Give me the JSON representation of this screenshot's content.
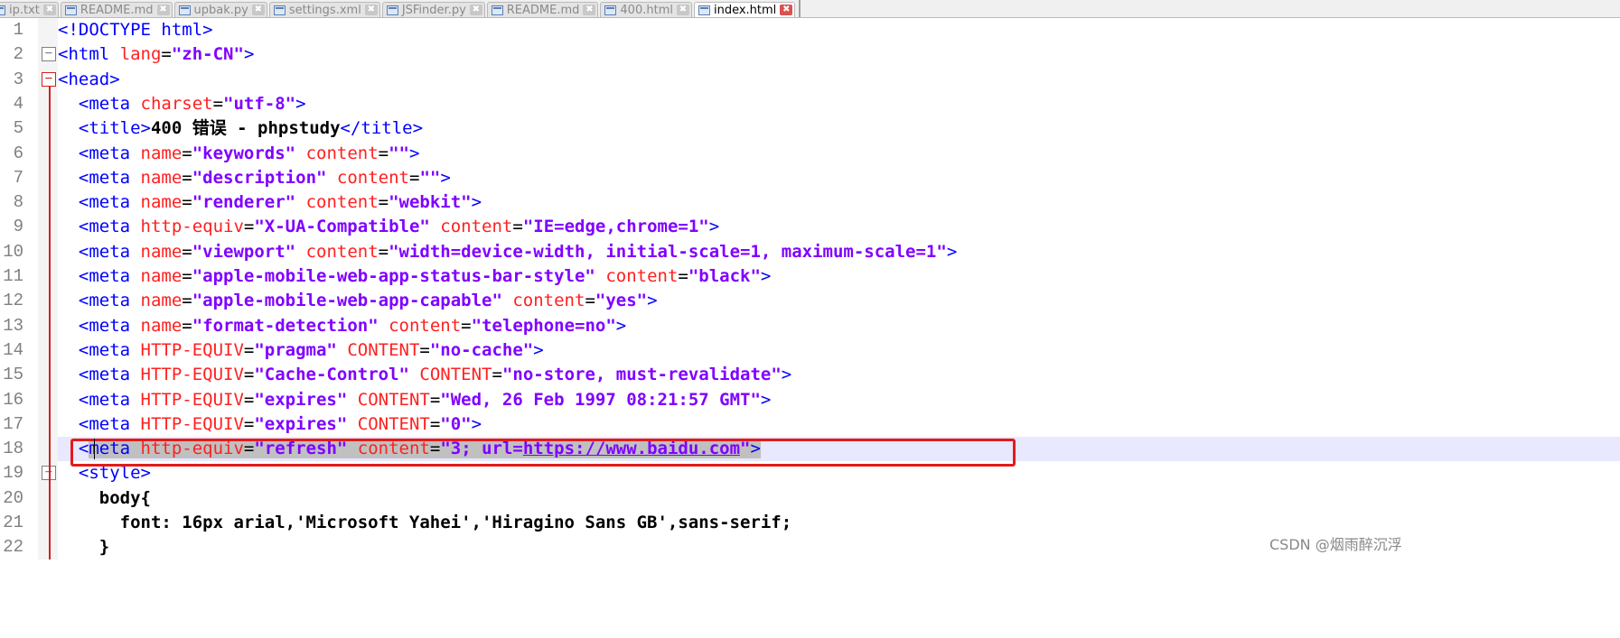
{
  "tabs": [
    {
      "label": "ip.txt"
    },
    {
      "label": "README.md"
    },
    {
      "label": "upbak.py"
    },
    {
      "label": "settings.xml"
    },
    {
      "label": "JSFinder.py"
    },
    {
      "label": "README.md"
    },
    {
      "label": "400.html"
    },
    {
      "label": "index.html",
      "active": true
    }
  ],
  "lines": [
    {
      "n": "1",
      "tokens": [
        [
          "tag",
          "<!DOCTYPE html>"
        ]
      ]
    },
    {
      "n": "2",
      "tokens": [
        [
          "tag",
          "<html "
        ],
        [
          "attr",
          "lang"
        ],
        [
          "eq",
          "="
        ],
        [
          "str",
          "\"zh-CN\""
        ],
        [
          "tag",
          ">"
        ]
      ]
    },
    {
      "n": "3",
      "tokens": [
        [
          "tag",
          "<head>"
        ]
      ]
    },
    {
      "n": "4",
      "tokens": [
        [
          "tag",
          "  <meta "
        ],
        [
          "attr",
          "charset"
        ],
        [
          "eq",
          "="
        ],
        [
          "str",
          "\"utf-8\""
        ],
        [
          "tag",
          ">"
        ]
      ]
    },
    {
      "n": "5",
      "tokens": [
        [
          "tag",
          "  <title>"
        ],
        [
          "txt",
          "400 错误 - phpstudy"
        ],
        [
          "tag",
          "</title>"
        ]
      ]
    },
    {
      "n": "6",
      "tokens": [
        [
          "tag",
          "  <meta "
        ],
        [
          "attr",
          "name"
        ],
        [
          "eq",
          "="
        ],
        [
          "str",
          "\"keywords\""
        ],
        [
          "tag",
          " "
        ],
        [
          "attr",
          "content"
        ],
        [
          "eq",
          "="
        ],
        [
          "str",
          "\"\""
        ],
        [
          "tag",
          ">"
        ]
      ]
    },
    {
      "n": "7",
      "tokens": [
        [
          "tag",
          "  <meta "
        ],
        [
          "attr",
          "name"
        ],
        [
          "eq",
          "="
        ],
        [
          "str",
          "\"description\""
        ],
        [
          "tag",
          " "
        ],
        [
          "attr",
          "content"
        ],
        [
          "eq",
          "="
        ],
        [
          "str",
          "\"\""
        ],
        [
          "tag",
          ">"
        ]
      ]
    },
    {
      "n": "8",
      "tokens": [
        [
          "tag",
          "  <meta "
        ],
        [
          "attr",
          "name"
        ],
        [
          "eq",
          "="
        ],
        [
          "str",
          "\"renderer\""
        ],
        [
          "tag",
          " "
        ],
        [
          "attr",
          "content"
        ],
        [
          "eq",
          "="
        ],
        [
          "str",
          "\"webkit\""
        ],
        [
          "tag",
          ">"
        ]
      ]
    },
    {
      "n": "9",
      "tokens": [
        [
          "tag",
          "  <meta "
        ],
        [
          "attr",
          "http-equiv"
        ],
        [
          "eq",
          "="
        ],
        [
          "str",
          "\"X-UA-Compatible\""
        ],
        [
          "tag",
          " "
        ],
        [
          "attr",
          "content"
        ],
        [
          "eq",
          "="
        ],
        [
          "str",
          "\"IE=edge,chrome=1\""
        ],
        [
          "tag",
          ">"
        ]
      ]
    },
    {
      "n": "10",
      "tokens": [
        [
          "tag",
          "  <meta "
        ],
        [
          "attr",
          "name"
        ],
        [
          "eq",
          "="
        ],
        [
          "str",
          "\"viewport\""
        ],
        [
          "tag",
          " "
        ],
        [
          "attr",
          "content"
        ],
        [
          "eq",
          "="
        ],
        [
          "str",
          "\"width=device-width, initial-scale=1, maximum-scale=1\""
        ],
        [
          "tag",
          ">"
        ]
      ]
    },
    {
      "n": "11",
      "tokens": [
        [
          "tag",
          "  <meta "
        ],
        [
          "attr",
          "name"
        ],
        [
          "eq",
          "="
        ],
        [
          "str",
          "\"apple-mobile-web-app-status-bar-style\""
        ],
        [
          "tag",
          " "
        ],
        [
          "attr",
          "content"
        ],
        [
          "eq",
          "="
        ],
        [
          "str",
          "\"black\""
        ],
        [
          "tag",
          ">"
        ]
      ]
    },
    {
      "n": "12",
      "tokens": [
        [
          "tag",
          "  <meta "
        ],
        [
          "attr",
          "name"
        ],
        [
          "eq",
          "="
        ],
        [
          "str",
          "\"apple-mobile-web-app-capable\""
        ],
        [
          "tag",
          " "
        ],
        [
          "attr",
          "content"
        ],
        [
          "eq",
          "="
        ],
        [
          "str",
          "\"yes\""
        ],
        [
          "tag",
          ">"
        ]
      ]
    },
    {
      "n": "13",
      "tokens": [
        [
          "tag",
          "  <meta "
        ],
        [
          "attr",
          "name"
        ],
        [
          "eq",
          "="
        ],
        [
          "str",
          "\"format-detection\""
        ],
        [
          "tag",
          " "
        ],
        [
          "attr",
          "content"
        ],
        [
          "eq",
          "="
        ],
        [
          "str",
          "\"telephone=no\""
        ],
        [
          "tag",
          ">"
        ]
      ]
    },
    {
      "n": "14",
      "tokens": [
        [
          "tag",
          "  <meta "
        ],
        [
          "attr",
          "HTTP-EQUIV"
        ],
        [
          "eq",
          "="
        ],
        [
          "str",
          "\"pragma\""
        ],
        [
          "tag",
          " "
        ],
        [
          "attr",
          "CONTENT"
        ],
        [
          "eq",
          "="
        ],
        [
          "str",
          "\"no-cache\""
        ],
        [
          "tag",
          ">"
        ]
      ]
    },
    {
      "n": "15",
      "tokens": [
        [
          "tag",
          "  <meta "
        ],
        [
          "attr",
          "HTTP-EQUIV"
        ],
        [
          "eq",
          "="
        ],
        [
          "str",
          "\"Cache-Control\""
        ],
        [
          "tag",
          " "
        ],
        [
          "attr",
          "CONTENT"
        ],
        [
          "eq",
          "="
        ],
        [
          "str",
          "\"no-store, must-revalidate\""
        ],
        [
          "tag",
          ">"
        ]
      ]
    },
    {
      "n": "16",
      "tokens": [
        [
          "tag",
          "  <meta "
        ],
        [
          "attr",
          "HTTP-EQUIV"
        ],
        [
          "eq",
          "="
        ],
        [
          "str",
          "\"expires\""
        ],
        [
          "tag",
          " "
        ],
        [
          "attr",
          "CONTENT"
        ],
        [
          "eq",
          "="
        ],
        [
          "str",
          "\"Wed, 26 Feb 1997 08:21:57 GMT\""
        ],
        [
          "tag",
          ">"
        ]
      ]
    },
    {
      "n": "17",
      "tokens": [
        [
          "tag",
          "  <meta "
        ],
        [
          "attr",
          "HTTP-EQUIV"
        ],
        [
          "eq",
          "="
        ],
        [
          "str",
          "\"expires\""
        ],
        [
          "tag",
          " "
        ],
        [
          "attr",
          "CONTENT"
        ],
        [
          "eq",
          "="
        ],
        [
          "str",
          "\"0\""
        ],
        [
          "tag",
          ">"
        ]
      ]
    },
    {
      "n": "18",
      "tokens": [
        [
          "tag",
          "  <"
        ],
        [
          "tag",
          "meta "
        ],
        [
          "attr",
          "http-equiv"
        ],
        [
          "eq",
          "="
        ],
        [
          "str",
          "\"refresh\""
        ],
        [
          "tag",
          " "
        ],
        [
          "attr",
          "content"
        ],
        [
          "eq",
          "="
        ],
        [
          "str",
          "\"3; url="
        ],
        [
          "strurl",
          "https://www.baidu.com"
        ],
        [
          "str",
          "\""
        ],
        [
          "tag",
          ">"
        ]
      ],
      "highlight": true
    },
    {
      "n": "19",
      "tokens": [
        [
          "tag",
          "  <style>"
        ]
      ]
    },
    {
      "n": "20",
      "tokens": [
        [
          "css",
          "    body{"
        ]
      ]
    },
    {
      "n": "21",
      "tokens": [
        [
          "css",
          "      font: 16px arial,'Microsoft Yahei','Hiragino Sans GB',sans-serif;"
        ]
      ]
    },
    {
      "n": "22",
      "tokens": [
        [
          "css",
          "    }"
        ]
      ]
    }
  ],
  "watermark": "CSDN @烟雨醉沉浮",
  "colors": {
    "tag": "#0000ff",
    "attribute": "#ff2020",
    "string": "#8000ff",
    "current_line": "#e8e8ff",
    "annotation_box": "#e21b1b"
  }
}
